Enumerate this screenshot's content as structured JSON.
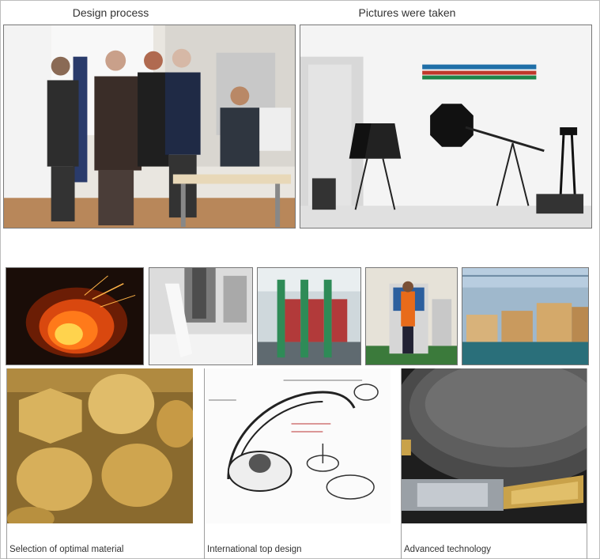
{
  "top_captions": {
    "left": "Design process",
    "right": "Pictures were taken"
  },
  "top_photos": {
    "left_icon": "design-meeting-photo",
    "right_icon": "photo-studio-photo"
  },
  "process_strip": [
    {
      "icon": "furnace-fire-photo"
    },
    {
      "icon": "casting-pour-photo"
    },
    {
      "icon": "machining-line-photo"
    },
    {
      "icon": "worker-machine-photo"
    },
    {
      "icon": "warehouse-boxes-photo"
    }
  ],
  "features": [
    {
      "label": "Selection of optimal material",
      "icon": "brass-rods-photo"
    },
    {
      "label": "International top design",
      "icon": "faucet-sketch-photo"
    },
    {
      "label": "Advanced technology",
      "icon": "grinding-wheel-photo"
    }
  ],
  "colors": {
    "border": "#777777",
    "caption_text": "#333333",
    "fire": "#ff7a1a",
    "brass": "#c9a24a"
  }
}
